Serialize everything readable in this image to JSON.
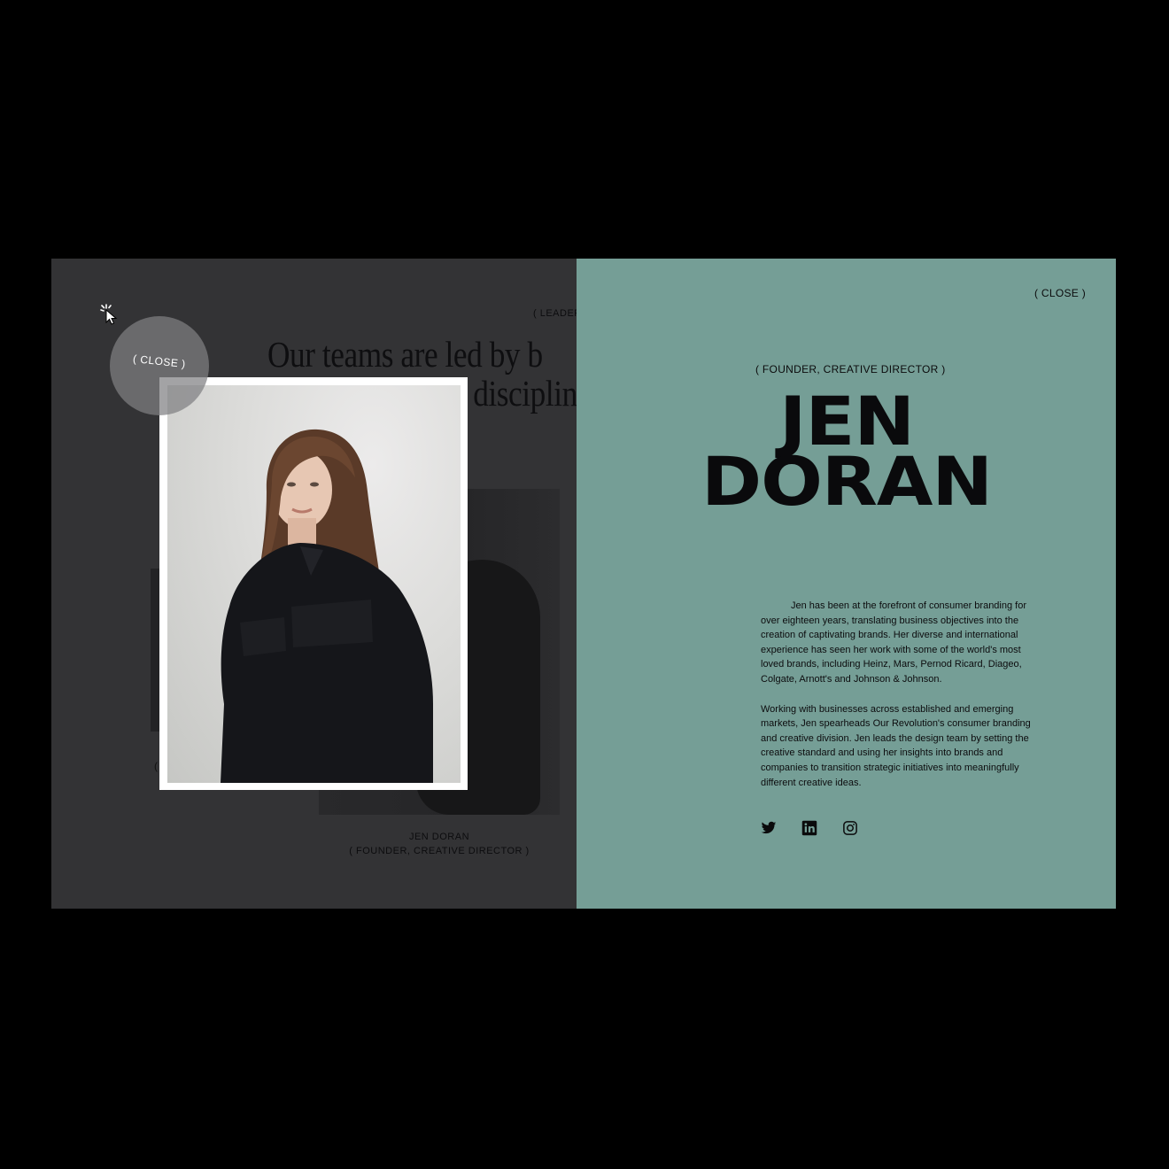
{
  "left_panel": {
    "eyebrow": "( LEADER",
    "headline_line1": "Our teams are led by b",
    "headline_line2": "disciplin",
    "bubble_close_label": "( CLOSE )",
    "paren_fragment": "(",
    "caption_name": "JEN DORAN",
    "caption_role": "( FOUNDER, CREATIVE DIRECTOR )"
  },
  "right_panel": {
    "close_label": "( CLOSE )",
    "role": "( FOUNDER, CREATIVE DIRECTOR )",
    "name_line1": "JEN",
    "name_line2": "DORAN",
    "bio_paragraph1": "Jen has been at the forefront of consumer branding for over eighteen years, translating business objectives into the creation of captivating brands. Her diverse and international experience has seen her work with some of the world's most loved brands, including Heinz, Mars, Pernod Ricard, Diageo, Colgate, Arnott's and Johnson & Johnson.",
    "bio_paragraph2": "Working with businesses across established and emerging markets, Jen spearheads Our Revolution's consumer branding and creative division. Jen leads the design team by setting the creative standard and using her insights into brands and companies to transition strategic initiatives into meaningfully different creative ideas.",
    "socials": [
      "twitter-icon",
      "linkedin-icon",
      "instagram-icon"
    ]
  },
  "colors": {
    "page_background": "#000000",
    "left_panel": "#333335",
    "right_panel": "#759e96",
    "text_dark": "#0b0b0c"
  }
}
